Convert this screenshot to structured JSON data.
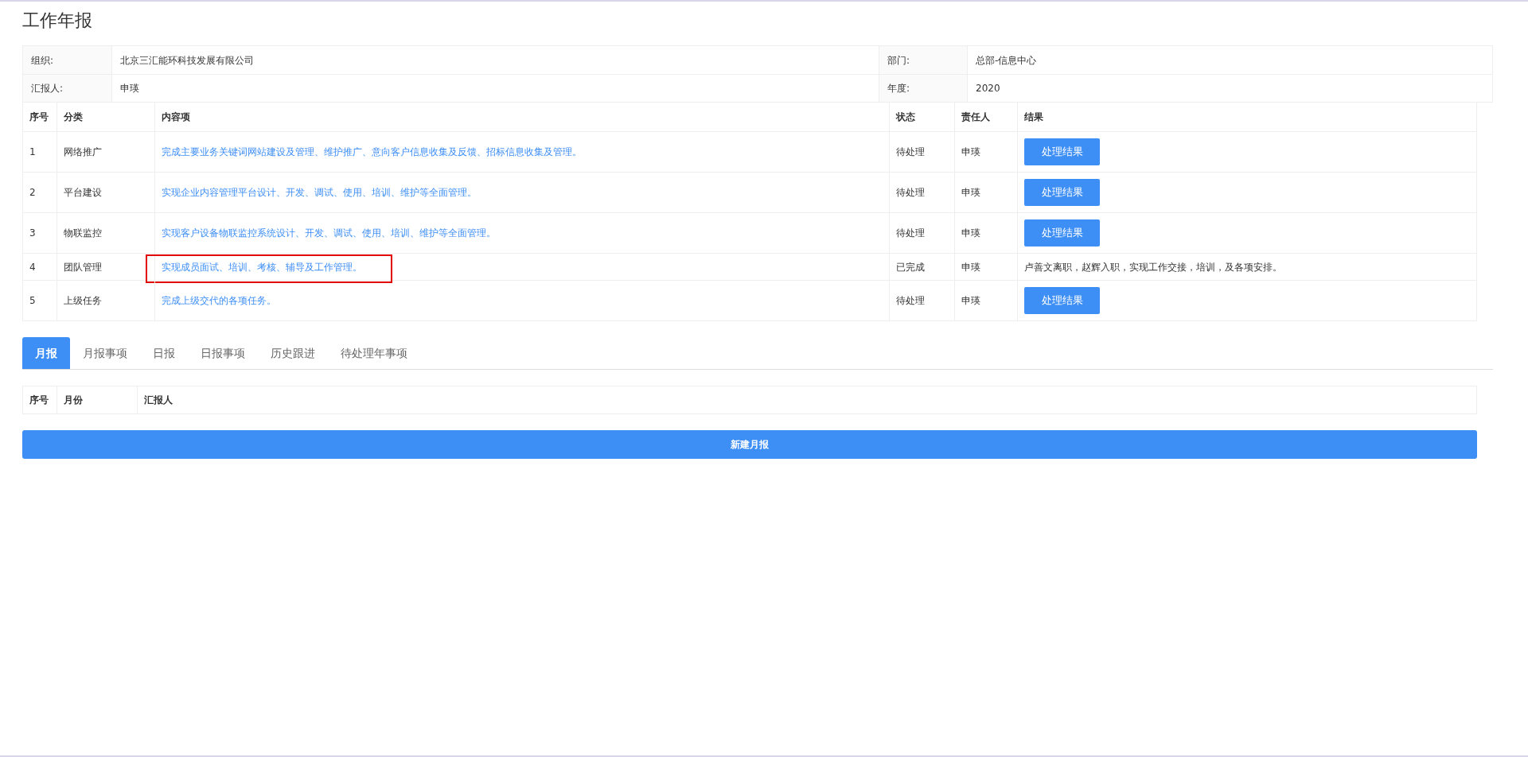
{
  "page_title": "工作年报",
  "info": [
    [
      {
        "label": "组织:",
        "value": "北京三汇能环科技发展有限公司"
      },
      {
        "label": "部门:",
        "value": "总部-信息中心"
      }
    ],
    [
      {
        "label": "汇报人:",
        "value": "申瑛"
      },
      {
        "label": "年度:",
        "value": "2020"
      }
    ]
  ],
  "table": {
    "columns": [
      "序号",
      "分类",
      "内容项",
      "状态",
      "责任人",
      "结果"
    ],
    "rows": [
      {
        "no": "1",
        "category": "网络推广",
        "content": "完成主要业务关键词网站建设及管理、维护推广、意向客户信息收集及反馈、招标信息收集及管理。",
        "status": "待处理",
        "owner": "申瑛",
        "result": {
          "kind": "button",
          "text": "处理结果"
        },
        "highlighted": false
      },
      {
        "no": "2",
        "category": "平台建设",
        "content": "实现企业内容管理平台设计、开发、调试、使用、培训、维护等全面管理。",
        "status": "待处理",
        "owner": "申瑛",
        "result": {
          "kind": "button",
          "text": "处理结果"
        },
        "highlighted": false
      },
      {
        "no": "3",
        "category": "物联监控",
        "content": "实现客户设备物联监控系统设计、开发、调试、使用、培训、维护等全面管理。",
        "status": "待处理",
        "owner": "申瑛",
        "result": {
          "kind": "button",
          "text": "处理结果"
        },
        "highlighted": false
      },
      {
        "no": "4",
        "category": "团队管理",
        "content": "实现成员面试、培训、考核、辅导及工作管理。",
        "status": "已完成",
        "owner": "申瑛",
        "result": {
          "kind": "text",
          "text": "卢善文离职，赵辉入职，实现工作交接，培训，及各项安排。"
        },
        "highlighted": true
      },
      {
        "no": "5",
        "category": "上级任务",
        "content": "完成上级交代的各项任务。",
        "status": "待处理",
        "owner": "申瑛",
        "result": {
          "kind": "button",
          "text": "处理结果"
        },
        "highlighted": false
      }
    ]
  },
  "tabs": [
    {
      "label": "月报",
      "selected": true
    },
    {
      "label": "月报事项",
      "selected": false
    },
    {
      "label": "日报",
      "selected": false
    },
    {
      "label": "日报事项",
      "selected": false
    },
    {
      "label": "历史跟进",
      "selected": false
    },
    {
      "label": "待处理年事项",
      "selected": false
    }
  ],
  "monthly_table": {
    "columns": [
      "序号",
      "月份",
      "汇报人"
    ]
  },
  "new_button": "新建月报"
}
